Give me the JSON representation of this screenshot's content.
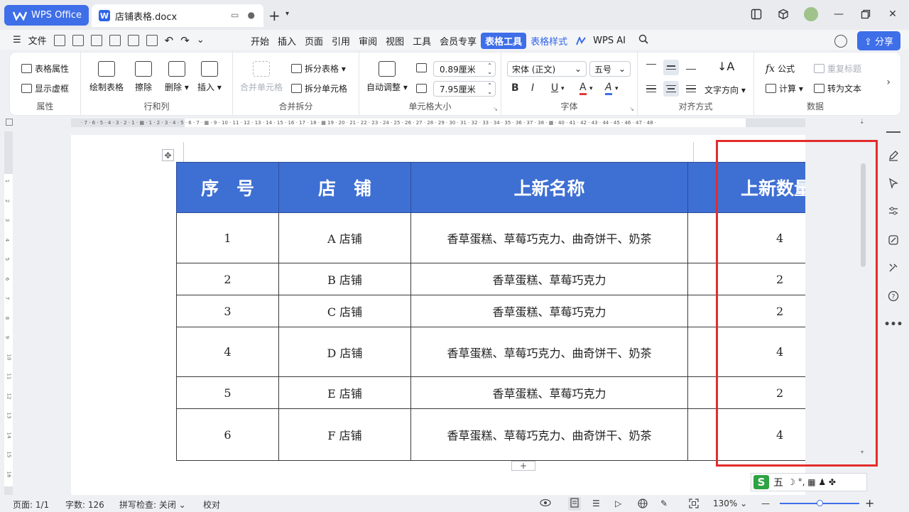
{
  "tabs": {
    "app": "WPS Office",
    "doc": "店铺表格.docx",
    "doc_icon": "W"
  },
  "menubar": {
    "file": "文件",
    "items": [
      "开始",
      "插入",
      "页面",
      "引用",
      "审阅",
      "视图",
      "工具",
      "会员专享",
      "表格工具",
      "表格样式"
    ],
    "active_index": 8,
    "wps_ai": "WPS AI",
    "share": "分享"
  },
  "ribbon": {
    "table_props": "表格属性",
    "show_gridlines": "显示虚框",
    "group_props": "属性",
    "draw_table": "绘制表格",
    "erase": "擦除",
    "delete": "删除",
    "insert": "插入",
    "group_rowcol": "行和列",
    "merge_cells": "合并单元格",
    "split_table": "拆分表格",
    "split_cells": "拆分单元格",
    "group_merge": "合并拆分",
    "auto_fit": "自动调整",
    "row_height": "0.89厘米",
    "col_width": "7.95厘米",
    "group_cellsize": "单元格大小",
    "font_name": "宋体 (正文)",
    "font_size": "五号",
    "bold": "B",
    "italic": "I",
    "underline": "U",
    "font_color": "A",
    "highlight": "A",
    "group_font": "字体",
    "text_direction": "文字方向",
    "group_align": "对齐方式",
    "formula": "公式",
    "repeat_header": "重复标题",
    "calculate": "计算",
    "convert_text": "转为文本",
    "group_data": "数据"
  },
  "ruler": {
    "numbers": "· 7 · 6 · 5 · 4 · 3 · 2 · 1 · ▦ · 1 · 2 · 3 · 4 · 5 · 6 · 7 · ▦ · 9 · 10 · 11 · 12 · 13 · 14 · 15 · 16 · 17 · 18 · ▦ 19 · 20 · 21 · 22 · 23 · 24 · 25 · 26 · 27 · 28 · 29 · 30 · 31 · 32 · 33 · 34 · 35 · 36 · 37 · 38 · ▦ · 40 · 41 · 42 · 43 · 44 · 45 · 46 · 47 · 48 ·"
  },
  "vruler_numbers": [
    "1",
    "2",
    "3",
    "4",
    "5",
    "6",
    "7",
    "8",
    "9",
    "10",
    "11",
    "12",
    "13",
    "14",
    "15",
    "16"
  ],
  "table": {
    "headers": [
      "序　号",
      "店　铺",
      "上新名称",
      "上新数量"
    ],
    "rows": [
      {
        "no": "1",
        "shop": "A 店铺",
        "name": "香草蛋糕、草莓巧克力、曲奇饼干、奶茶",
        "qty": "4"
      },
      {
        "no": "2",
        "shop": "B 店铺",
        "name": "香草蛋糕、草莓巧克力",
        "qty": "2"
      },
      {
        "no": "3",
        "shop": "C 店铺",
        "name": "香草蛋糕、草莓巧克力",
        "qty": "2"
      },
      {
        "no": "4",
        "shop": "D 店铺",
        "name": "香草蛋糕、草莓巧克力、曲奇饼干、奶茶",
        "qty": "4"
      },
      {
        "no": "5",
        "shop": "E 店铺",
        "name": "香草蛋糕、草莓巧克力",
        "qty": "2"
      },
      {
        "no": "6",
        "shop": "F 店铺",
        "name": "香草蛋糕、草莓巧克力、曲奇饼干、奶茶",
        "qty": "4"
      }
    ]
  },
  "ime": {
    "logo": "S",
    "mode": "五",
    "symbols": "☽ °, ▦ ♟ ✤"
  },
  "status": {
    "page": "页面: 1/1",
    "words": "字数: 126",
    "spell": "拼写检查: 关闭",
    "proof": "校对",
    "zoom": "130%",
    "zoom_level_percent": 130
  },
  "colors": {
    "accent": "#3e6ee8",
    "header_fill": "#3e6fd3",
    "annotation": "#e32c2c"
  }
}
